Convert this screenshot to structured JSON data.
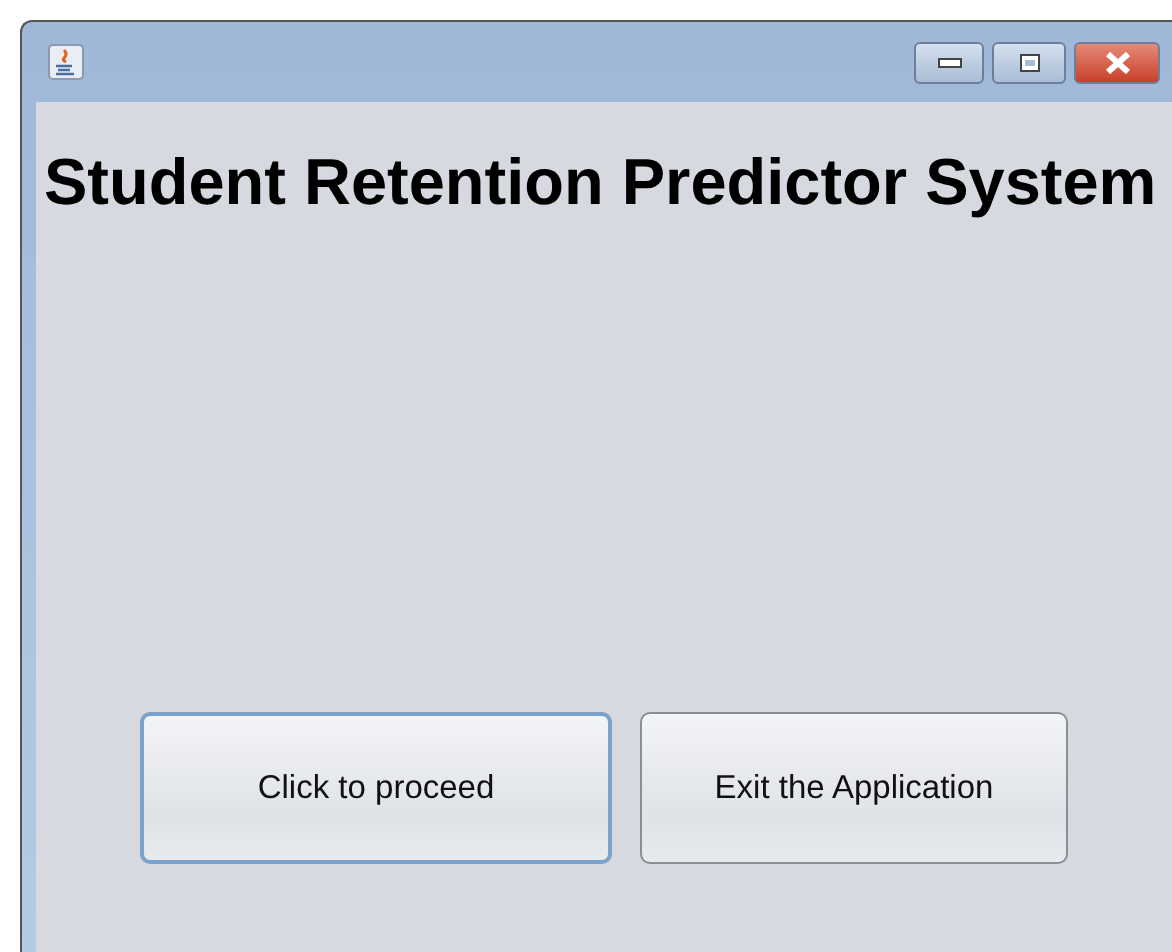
{
  "window": {
    "title_buttons": [
      {
        "kind": "minimize"
      },
      {
        "kind": "maximize"
      },
      {
        "kind": "close"
      }
    ]
  },
  "heading": "Student Retention Predictor System",
  "buttons": [
    {
      "label": "Click to proceed",
      "focused": true
    },
    {
      "label": "Exit the Application",
      "focused": false
    }
  ]
}
